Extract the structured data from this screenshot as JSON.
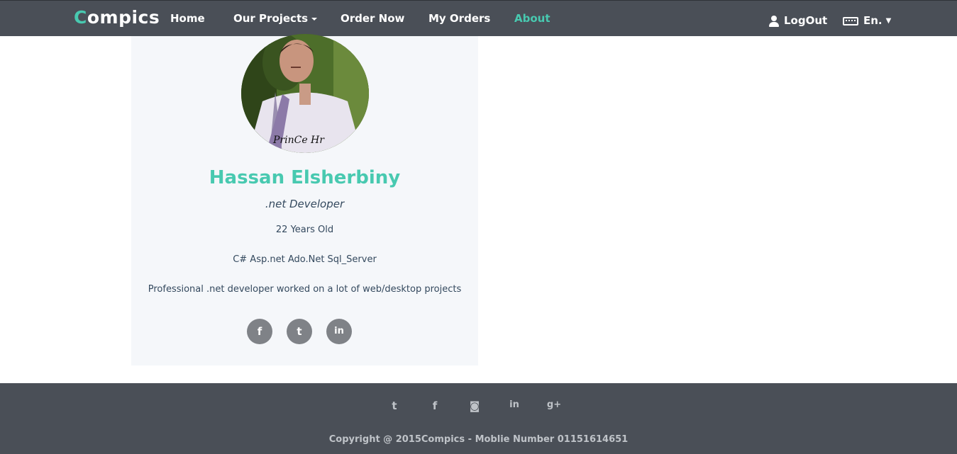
{
  "navbar": {
    "brand_first": "C",
    "brand_rest": "ompics",
    "items": [
      {
        "label": "Home"
      },
      {
        "label": "Our Projects"
      },
      {
        "label": "Order Now"
      },
      {
        "label": "My Orders"
      },
      {
        "label": "About"
      }
    ],
    "logout_label": "LogOut",
    "language_label": "En.",
    "accent_color": "#48c9b0",
    "bar_color": "#4a4f57"
  },
  "profile": {
    "signature": "PrinCe Hr",
    "name": "Hassan Elsherbiny",
    "role": ".net Developer",
    "age": "22 Years Old",
    "skills": "C# Asp.net Ado.Net Sql_Server",
    "bio": "Professional .net developer worked on a lot of web/desktop projects",
    "social": [
      {
        "icon": "facebook-icon",
        "glyph": "f"
      },
      {
        "icon": "twitter-icon",
        "glyph": "t"
      },
      {
        "icon": "linkedin-icon",
        "glyph": "in"
      }
    ]
  },
  "footer": {
    "icons": [
      {
        "icon": "twitter-icon",
        "glyph": "t"
      },
      {
        "icon": "facebook-icon",
        "glyph": "f"
      },
      {
        "icon": "instagram-icon",
        "glyph": "◙"
      },
      {
        "icon": "linkedin-icon",
        "glyph": "in"
      },
      {
        "icon": "google-plus-icon",
        "glyph": "g+"
      }
    ],
    "copyright": "Copyright @ 2015Compics - Moblie Number 01151614651"
  }
}
